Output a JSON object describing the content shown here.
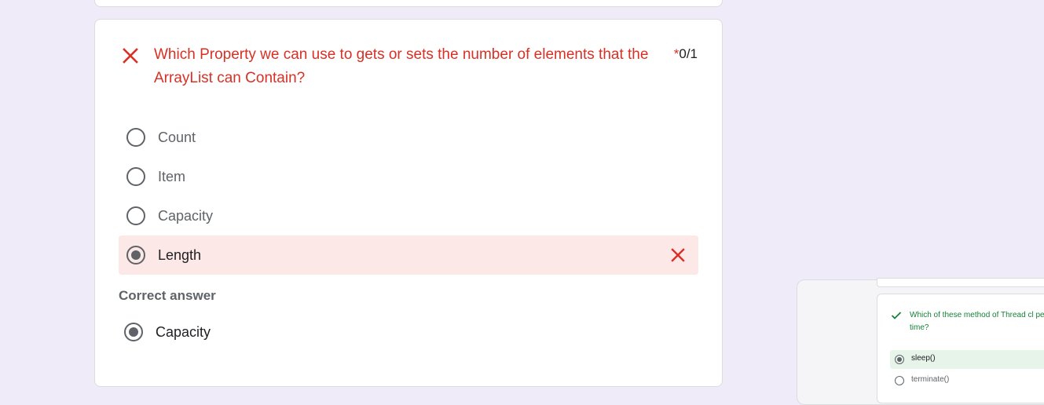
{
  "colors": {
    "page_background": "#f0ebf8",
    "incorrect": "#d93025",
    "incorrect_background": "#fce8e6",
    "correct": "#188038",
    "correct_background": "#e6f4ea"
  },
  "question": {
    "status_icon": "close-icon",
    "title": "Which Property we can use to gets or sets the number of elements that the ArrayList can Contain?",
    "required_mark": "*",
    "score": "0/1",
    "options": [
      {
        "label": "Count",
        "selected": false
      },
      {
        "label": "Item",
        "selected": false
      },
      {
        "label": "Capacity",
        "selected": false
      },
      {
        "label": "Length",
        "selected": true,
        "result_icon": "close-icon"
      }
    ],
    "correct_answer_heading": "Correct answer",
    "correct_answer": "Capacity"
  },
  "preview": {
    "status_icon": "check-icon",
    "title": "Which of these method of Thread cl period of time?",
    "options": [
      {
        "label": "sleep()",
        "selected": true
      },
      {
        "label": "terminate()",
        "selected": false
      }
    ]
  }
}
